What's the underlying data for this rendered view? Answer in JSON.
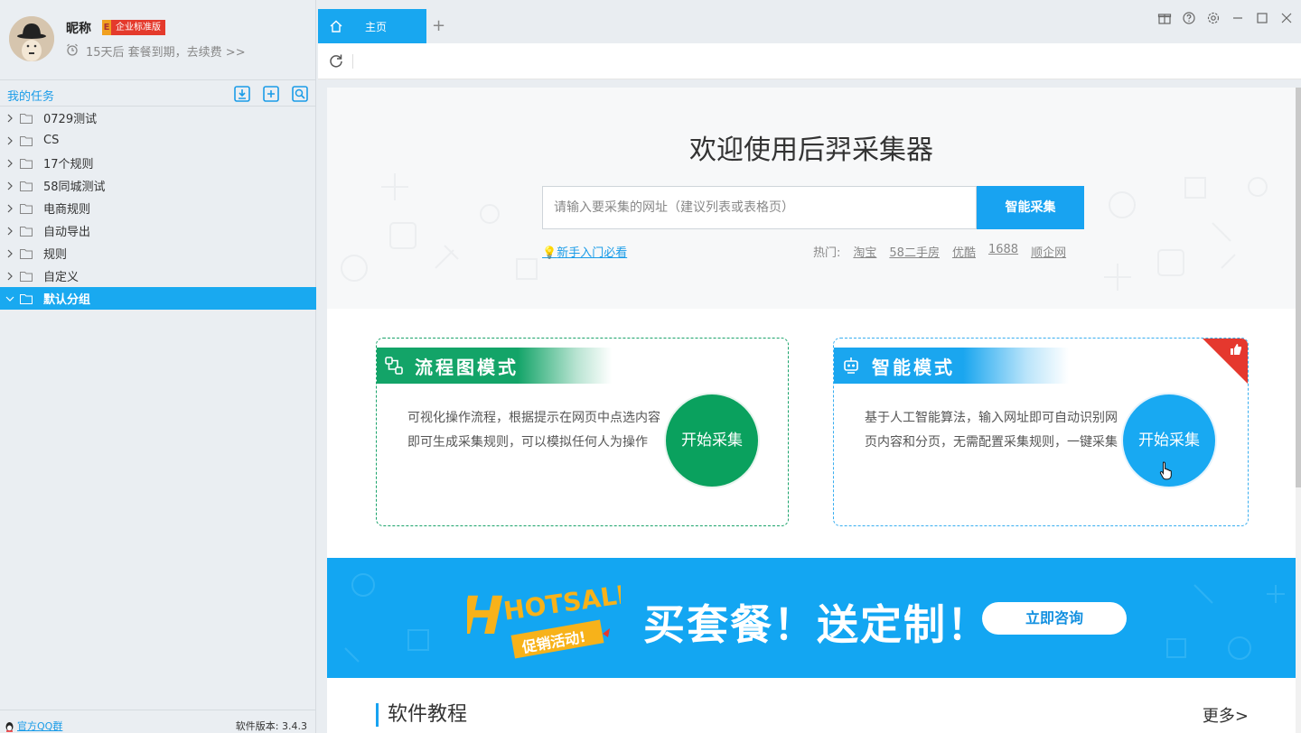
{
  "user": {
    "nickname": "昵称",
    "badge_e": "E",
    "badge_label": "企业标准版",
    "expire_text": "15天后 套餐到期，去续费 >>"
  },
  "sidebar": {
    "section_title": "我的任务",
    "items": [
      {
        "label": "0729测试"
      },
      {
        "label": "CS"
      },
      {
        "label": "17个规则"
      },
      {
        "label": "58同城测试"
      },
      {
        "label": "电商规则"
      },
      {
        "label": "自动导出"
      },
      {
        "label": "规则"
      },
      {
        "label": "自定义"
      },
      {
        "label": "默认分组",
        "selected": true
      }
    ],
    "footer_link": "官方QQ群",
    "version": "软件版本: 3.4.3"
  },
  "tabs": {
    "home_label": "主页",
    "add_label": "+"
  },
  "main": {
    "title": "欢迎使用后羿采集器",
    "search_placeholder": "请输入要采集的网址（建议列表或表格页）",
    "search_button": "智能采集",
    "newbie_link": "新手入门必看",
    "hot_label": "热门:",
    "hot_links": [
      "淘宝",
      "58二手房",
      "优酷",
      "1688",
      "顺企网"
    ]
  },
  "cards": {
    "flow": {
      "title": "流程图模式",
      "desc": "可视化操作流程，根据提示在网页中点选内容即可生成采集规则，可以模拟任何人为操作",
      "button": "开始采集"
    },
    "smart": {
      "title": "智能模式",
      "desc": "基于人工智能算法，输入网址即可自动识别网页内容和分页，无需配置采集规则，一键采集",
      "button": "开始采集"
    }
  },
  "banner": {
    "logo_text": "HOTSALE",
    "logo_sub": "促销活动!",
    "text": "买套餐！送定制！",
    "button": "立即咨询"
  },
  "tutorial": {
    "title": "软件教程",
    "more": "更多>"
  },
  "colors": {
    "accent": "#18a3f1",
    "flow_green": "#0aa15e",
    "badge_red": "#e43a2c"
  }
}
